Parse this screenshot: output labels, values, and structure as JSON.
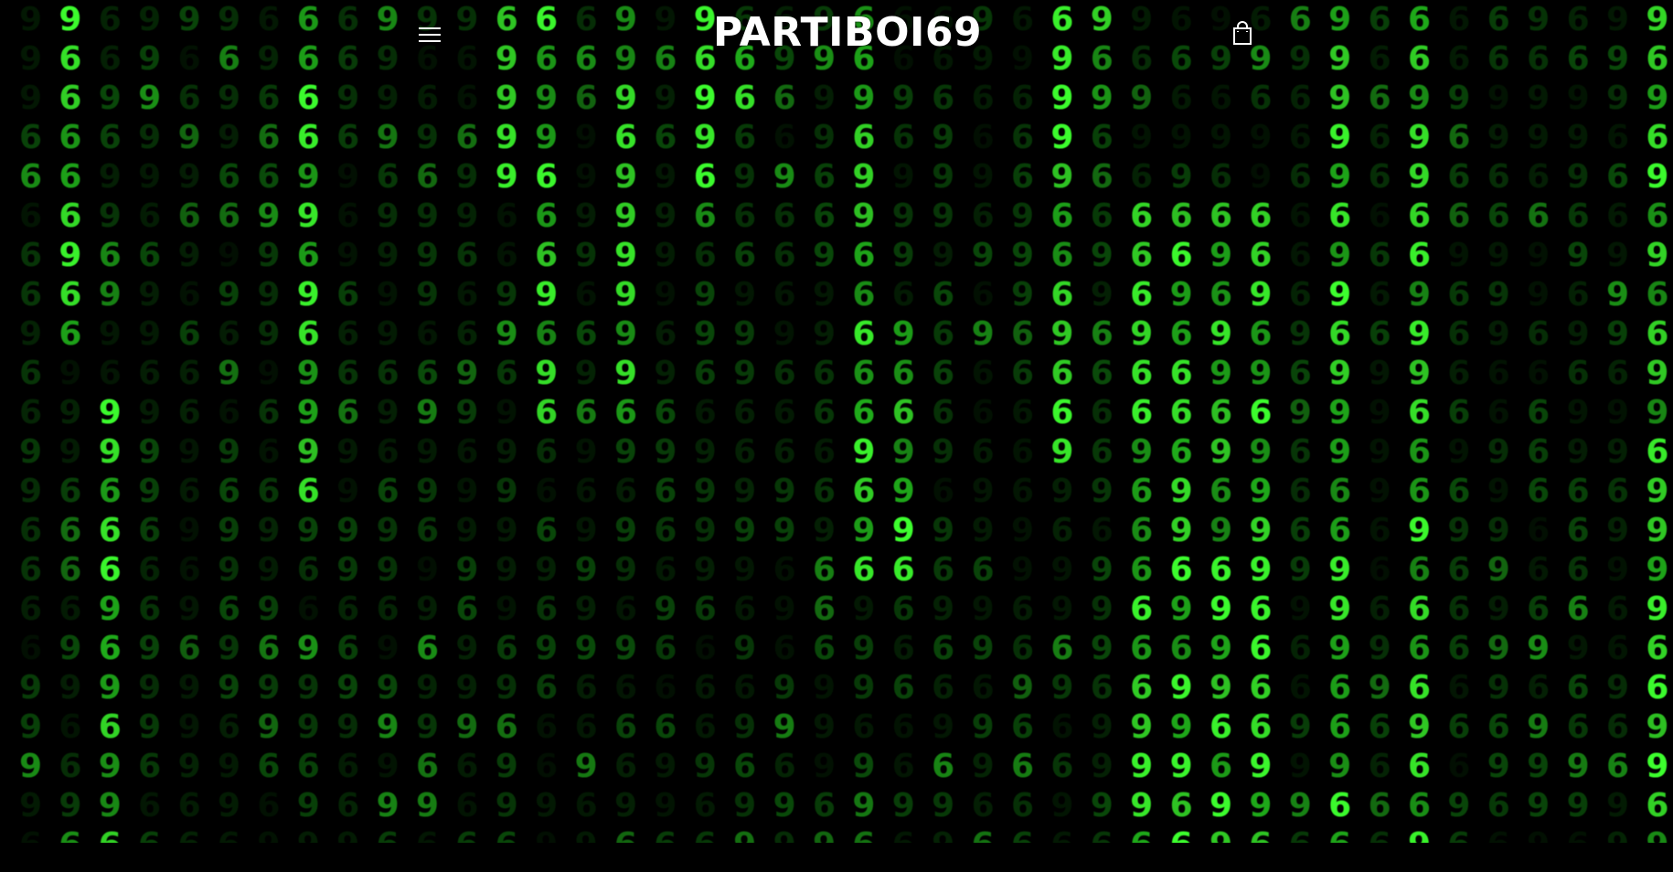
{
  "header": {
    "menu_icon": "hamburger-menu-icon",
    "site_title": "PARTIBOI69",
    "cart_icon": "shopping-bag-icon"
  },
  "hero": {
    "background": "matrix digital rain",
    "glyphs": [
      "6",
      "9"
    ]
  },
  "colors": {
    "page_background": "#000000",
    "header_text": "#ffffff",
    "rain_bright": "#3dff2e",
    "rain_mid": "#1faa1a",
    "rain_dim": "#0a4a0a"
  }
}
